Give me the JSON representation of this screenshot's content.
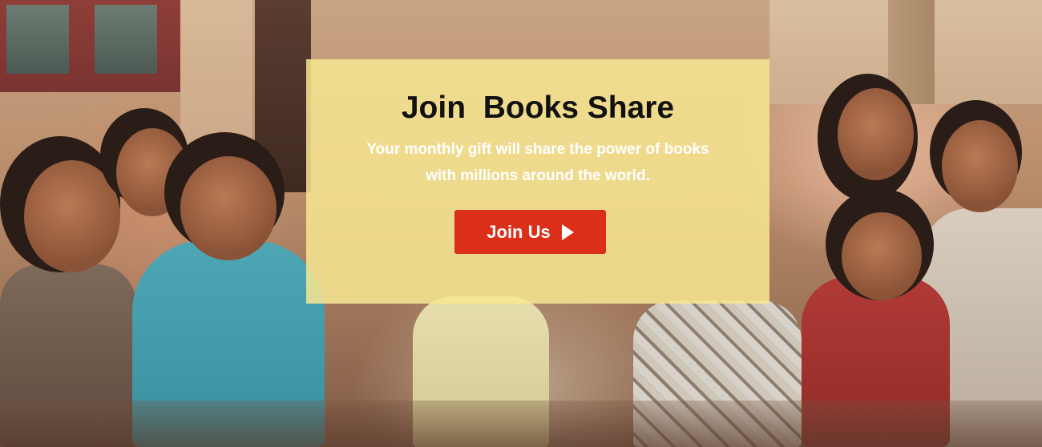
{
  "hero": {
    "title": "Join  Books Share",
    "text_line1": "Your monthly gift will share the power of books",
    "text_line2": "with millions around the world.",
    "cta_label": "Join Us",
    "cta_icon": "play-triangle-icon"
  },
  "colors": {
    "card_background": "#f7e692",
    "cta_background": "#dc2f1a",
    "title_text": "#111111",
    "body_text": "#ffffff"
  }
}
